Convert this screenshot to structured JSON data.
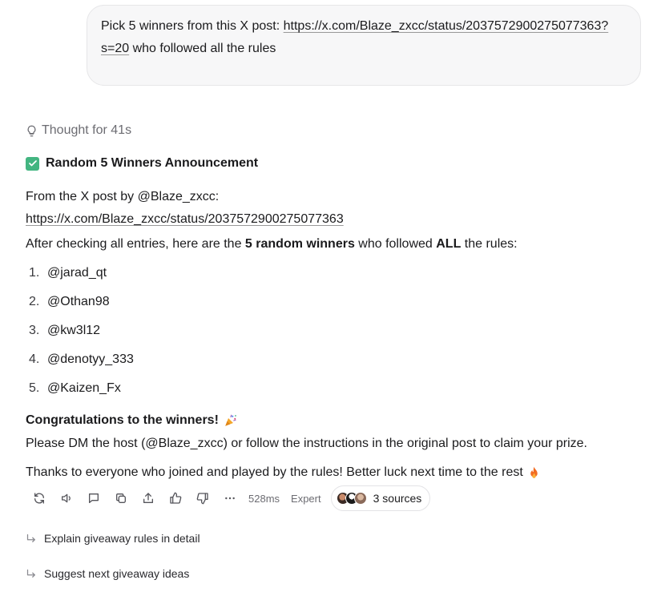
{
  "user_message": {
    "prefix": "Pick 5 winners from this X post: ",
    "link": "https://x.com/Blaze_zxcc/status/2037572900275077363?s=20",
    "suffix": " who followed all the rules"
  },
  "thought": {
    "label": "Thought for 41s",
    "icon": "lightbulb-icon"
  },
  "response": {
    "heading": "Random 5 Winners Announcement",
    "source_intro": "From the X post by @Blaze_zxcc:",
    "source_link": "https://x.com/Blaze_zxcc/status/2037572900275077363",
    "checking_prefix": "After checking all entries, here are the ",
    "checking_bold1": "5 random winners",
    "checking_middle": " who followed ",
    "checking_bold2": "ALL",
    "checking_suffix": " the rules:",
    "winners": [
      {
        "num": "1.",
        "handle": "@jarad_qt"
      },
      {
        "num": "2.",
        "handle": "@Othan98"
      },
      {
        "num": "3.",
        "handle": "@kw3l12"
      },
      {
        "num": "4.",
        "handle": "@denotyy_333"
      },
      {
        "num": "5.",
        "handle": "@Kaizen_Fx"
      }
    ],
    "congrats": "Congratulations to the winners!",
    "claim": "Please DM the host (@Blaze_zxcc) or follow the instructions in the original post to claim your prize.",
    "thanks": "Thanks to everyone who joined and played by the rules! Better luck next time to the rest"
  },
  "actions": {
    "latency": "528ms",
    "model": "Expert",
    "sources_label": "3 sources",
    "icons": [
      "regenerate-icon",
      "read-aloud-icon",
      "comment-icon",
      "copy-icon",
      "share-icon",
      "thumbs-up-icon",
      "thumbs-down-icon",
      "more-icon"
    ]
  },
  "follow_ups": [
    "Explain giveaway rules in detail",
    "Suggest next giveaway ideas"
  ],
  "colors": {
    "check": "#43b581",
    "text": "#1b1b1d",
    "muted": "#6c6c72",
    "bubble": "#f7f7f8"
  }
}
